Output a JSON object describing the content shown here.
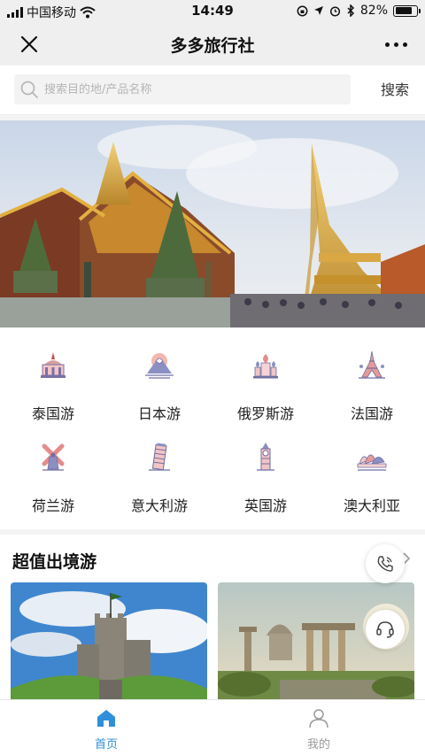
{
  "status_bar": {
    "carrier": "中国移动",
    "time": "14:49",
    "battery": "82%",
    "battery_level": 0.82
  },
  "nav": {
    "title": "多多旅行社",
    "close_icon": "close-icon",
    "more_icon": "more-dots-icon"
  },
  "search": {
    "placeholder": "搜索目的地/产品名称",
    "button_label": "搜索"
  },
  "categories": [
    {
      "label": "泰国游",
      "icon": "thai-temple-icon"
    },
    {
      "label": "日本游",
      "icon": "mount-fuji-icon"
    },
    {
      "label": "俄罗斯游",
      "icon": "kremlin-icon"
    },
    {
      "label": "法国游",
      "icon": "eiffel-tower-icon"
    },
    {
      "label": "荷兰游",
      "icon": "windmill-icon"
    },
    {
      "label": "意大利游",
      "icon": "leaning-tower-icon"
    },
    {
      "label": "英国游",
      "icon": "big-ben-icon"
    },
    {
      "label": "澳大利亚",
      "icon": "opera-house-icon"
    }
  ],
  "section": {
    "title": "超值出境游"
  },
  "tabs": [
    {
      "label": "首页",
      "icon": "home-icon",
      "active": true
    },
    {
      "label": "我的",
      "icon": "user-icon",
      "active": false
    }
  ],
  "colors": {
    "accent": "#2f8fd8",
    "inactive": "#999999",
    "background": "#f4f4f4"
  }
}
